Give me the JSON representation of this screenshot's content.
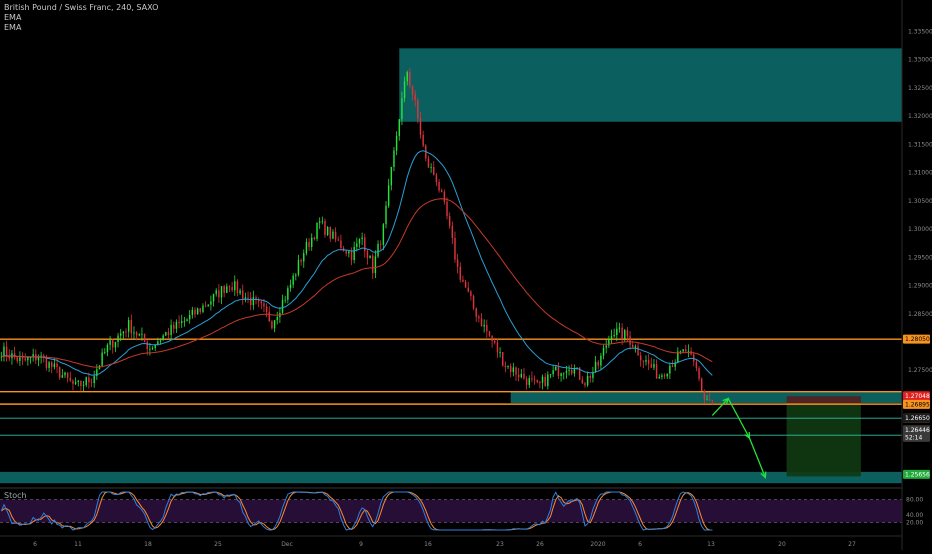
{
  "legend": {
    "title": "British Pound / Swiss Franc, 240, SAXO",
    "ema1": "EMA",
    "ema2": "EMA"
  },
  "stoch_label": "Stoch",
  "colors": {
    "background": "#000000",
    "up": "#26e13a",
    "down": "#e0323a",
    "ema_fast": "#2a9fd6",
    "ema_slow": "#c63a2a",
    "resistance": "#f7931e",
    "zone": "#0b5f5f",
    "arrow": "#22e33b",
    "stoch_k": "#2f7fe0",
    "stoch_d": "#ff8a2a",
    "stoch_band": "#2a0f3d"
  },
  "chart_data": {
    "type": "candlestick",
    "title": "British Pound / Swiss Franc, 240, SAXO",
    "ylim": [
      1.2545,
      1.3395
    ],
    "y_ticks": [
      1.335,
      1.33,
      1.325,
      1.32,
      1.315,
      1.31,
      1.305,
      1.3,
      1.295,
      1.29,
      1.285,
      1.275
    ],
    "x_ticks": [
      "6",
      "11",
      "18",
      "25",
      "Dec",
      "9",
      "16",
      "23",
      "26",
      "2020",
      "6",
      "13",
      "20",
      "27"
    ],
    "anchors": [
      [
        0,
        1.2785
      ],
      [
        8,
        1.2765
      ],
      [
        14,
        1.2775
      ],
      [
        22,
        1.2745
      ],
      [
        28,
        1.272
      ],
      [
        34,
        1.2735
      ],
      [
        40,
        1.279
      ],
      [
        48,
        1.283
      ],
      [
        56,
        1.279
      ],
      [
        62,
        1.2815
      ],
      [
        70,
        1.284
      ],
      [
        78,
        1.287
      ],
      [
        86,
        1.2905
      ],
      [
        92,
        1.288
      ],
      [
        98,
        1.286
      ],
      [
        102,
        1.2835
      ],
      [
        108,
        1.289
      ],
      [
        114,
        1.296
      ],
      [
        120,
        1.301
      ],
      [
        126,
        1.298
      ],
      [
        132,
        1.2955
      ],
      [
        136,
        1.2985
      ],
      [
        140,
        1.293
      ],
      [
        144,
        1.3
      ],
      [
        150,
        1.32
      ],
      [
        153,
        1.328
      ],
      [
        156,
        1.322
      ],
      [
        160,
        1.312
      ],
      [
        164,
        1.309
      ],
      [
        168,
        1.302
      ],
      [
        172,
        1.293
      ],
      [
        178,
        1.286
      ],
      [
        184,
        1.281
      ],
      [
        190,
        1.276
      ],
      [
        196,
        1.274
      ],
      [
        202,
        1.272
      ],
      [
        208,
        1.2745
      ],
      [
        214,
        1.276
      ],
      [
        220,
        1.273
      ],
      [
        225,
        1.276
      ],
      [
        230,
        1.282
      ],
      [
        236,
        1.281
      ],
      [
        242,
        1.277
      ],
      [
        248,
        1.274
      ],
      [
        254,
        1.277
      ],
      [
        258,
        1.2785
      ],
      [
        262,
        1.275
      ],
      [
        265,
        1.27
      ],
      [
        268,
        1.2695
      ]
    ],
    "ema_fast_period": 21,
    "ema_slow_period": 55,
    "annotations": {
      "zone_top": [
        1.332,
        1.319
      ],
      "zone_mid": [
        1.2712,
        1.2692
      ],
      "zone_bottom": [
        1.257,
        1.255
      ],
      "resistance_levels": [
        1.2805,
        1.2712,
        1.269
      ],
      "support_lines": [
        1.2665,
        1.2635
      ],
      "arrow_path": [
        [
          268,
          1.267
        ],
        [
          274,
          1.27
        ],
        [
          282,
          1.263
        ],
        [
          288,
          1.256
        ]
      ],
      "position_box": {
        "x_start": 296,
        "x_end": 324,
        "risk": [
          1.2704,
          1.269
        ],
        "reward": [
          1.269,
          1.2562
        ]
      }
    },
    "price_tags": [
      {
        "label": "1.28050",
        "value": 1.2805,
        "bg": "#f7931e",
        "fg": "#000000"
      },
      {
        "label": "1.27048",
        "value": 1.27048,
        "bg": "#e02020",
        "fg": "#ffffff"
      },
      {
        "label": "1.26895",
        "value": 1.26895,
        "bg": "#f7931e",
        "fg": "#000000"
      },
      {
        "label": "1.26649",
        "value": 1.26649,
        "bg": "#f7931e",
        "fg": "#000000"
      },
      {
        "label": "1.26650",
        "value": 1.2665,
        "bg": "#1b1b1b",
        "fg": "#ffffff"
      },
      {
        "label": "1.26446",
        "value": 1.26446,
        "bg": "#3a3a3a",
        "fg": "#ffffff"
      },
      {
        "label": "52:14",
        "value": 1.2631,
        "bg": "#3a3a3a",
        "fg": "#ffffff"
      },
      {
        "label": "1.25656",
        "value": 1.25656,
        "bg": "#1faa3a",
        "fg": "#ffffff"
      }
    ],
    "stoch": {
      "ylim": [
        0,
        100
      ],
      "levels": [
        80,
        20
      ],
      "y_ticks": [
        "80.00",
        "40.00",
        "20.00"
      ]
    }
  }
}
